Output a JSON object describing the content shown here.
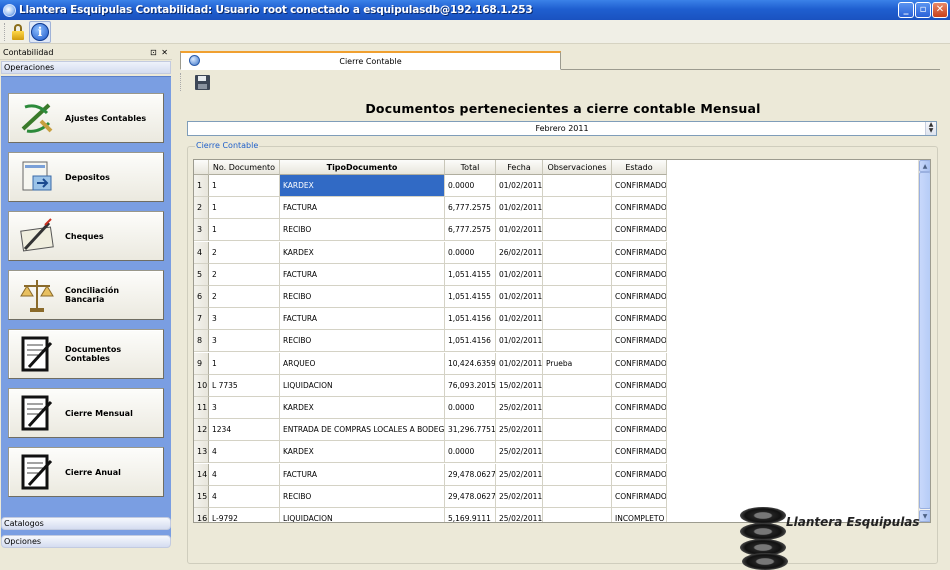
{
  "window": {
    "title": "Llantera Esquipulas Contabilidad: Usuario root conectado a esquipulasdb@192.168.1.253",
    "controls": {
      "minimize": "_",
      "maximize": "▫",
      "close": "✕"
    }
  },
  "toolbar": {
    "icons": [
      "lock-icon",
      "info-icon"
    ],
    "info_glyph": "i"
  },
  "sidebar": {
    "title": "Contabilidad",
    "title_controls": "⊡ ✕",
    "sections": {
      "top": "Operaciones",
      "catalogs": "Catalogos",
      "options": "Opciones"
    },
    "buttons": [
      {
        "label": "Ajustes Contables",
        "icon": "adjust-icon"
      },
      {
        "label": "Depositos",
        "icon": "deposit-icon"
      },
      {
        "label": "Cheques",
        "icon": "check-icon"
      },
      {
        "label": "Conciliación\nBancaria",
        "icon": "scale-icon"
      },
      {
        "label": "Documentos\nContables",
        "icon": "document-icon"
      },
      {
        "label": "Cierre Mensual",
        "icon": "document-icon"
      },
      {
        "label": "Cierre Anual",
        "icon": "document-icon"
      }
    ]
  },
  "main": {
    "tab": "Cierre Contable",
    "heading": "Documentos pertenecientes a cierre contable Mensual",
    "month": "Febrero 2011",
    "group_label": "Cierre Contable",
    "columns": [
      "No. Documento",
      "TipoDocumento",
      "Total",
      "Fecha",
      "Observaciones",
      "Estado"
    ],
    "rows": [
      [
        "1",
        "1",
        "KARDEX",
        "0.0000",
        "01/02/2011",
        "",
        "CONFIRMADO"
      ],
      [
        "2",
        "1",
        "FACTURA",
        "6,777.2575",
        "01/02/2011",
        "",
        "CONFIRMADO"
      ],
      [
        "3",
        "1",
        "RECIBO",
        "6,777.2575",
        "01/02/2011",
        "",
        "CONFIRMADO"
      ],
      [
        "4",
        "2",
        "KARDEX",
        "0.0000",
        "26/02/2011",
        "",
        "CONFIRMADO"
      ],
      [
        "5",
        "2",
        "FACTURA",
        "1,051.4155",
        "01/02/2011",
        "",
        "CONFIRMADO"
      ],
      [
        "6",
        "2",
        "RECIBO",
        "1,051.4155",
        "01/02/2011",
        "",
        "CONFIRMADO"
      ],
      [
        "7",
        "3",
        "FACTURA",
        "1,051.4156",
        "01/02/2011",
        "",
        "CONFIRMADO"
      ],
      [
        "8",
        "3",
        "RECIBO",
        "1,051.4156",
        "01/02/2011",
        "",
        "CONFIRMADO"
      ],
      [
        "9",
        "1",
        "ARQUEO",
        "10,424.6359",
        "01/02/2011",
        "Prueba",
        "CONFIRMADO"
      ],
      [
        "10",
        "L 7735",
        "LIQUIDACION",
        "76,093.2015",
        "15/02/2011",
        "",
        "CONFIRMADO"
      ],
      [
        "11",
        "3",
        "KARDEX",
        "0.0000",
        "25/02/2011",
        "",
        "CONFIRMADO"
      ],
      [
        "12",
        "1234",
        "ENTRADA DE COMPRAS LOCALES A BODEGA",
        "31,296.7751",
        "25/02/2011",
        "",
        "CONFIRMADO"
      ],
      [
        "13",
        "4",
        "KARDEX",
        "0.0000",
        "25/02/2011",
        "",
        "CONFIRMADO"
      ],
      [
        "14",
        "4",
        "FACTURA",
        "29,478.0627",
        "25/02/2011",
        "",
        "CONFIRMADO"
      ],
      [
        "15",
        "4",
        "RECIBO",
        "29,478.0627",
        "25/02/2011",
        "",
        "CONFIRMADO"
      ],
      [
        "16",
        "L-9792",
        "LIQUIDACION",
        "5,169.9111",
        "25/02/2011",
        "",
        "INCOMPLETO"
      ]
    ],
    "selected_cell": {
      "row": 0,
      "column": "TipoDocumento"
    },
    "scroll": {
      "up": "▲",
      "down": "▼"
    }
  },
  "brand": {
    "logo_text": "Llantera Esquipulas"
  },
  "colors": {
    "selection": "#316ac5",
    "sidebar_panel": "#7a9ee2",
    "titlebar": "#1f5fd0",
    "tab_accent": "#f0a030"
  }
}
